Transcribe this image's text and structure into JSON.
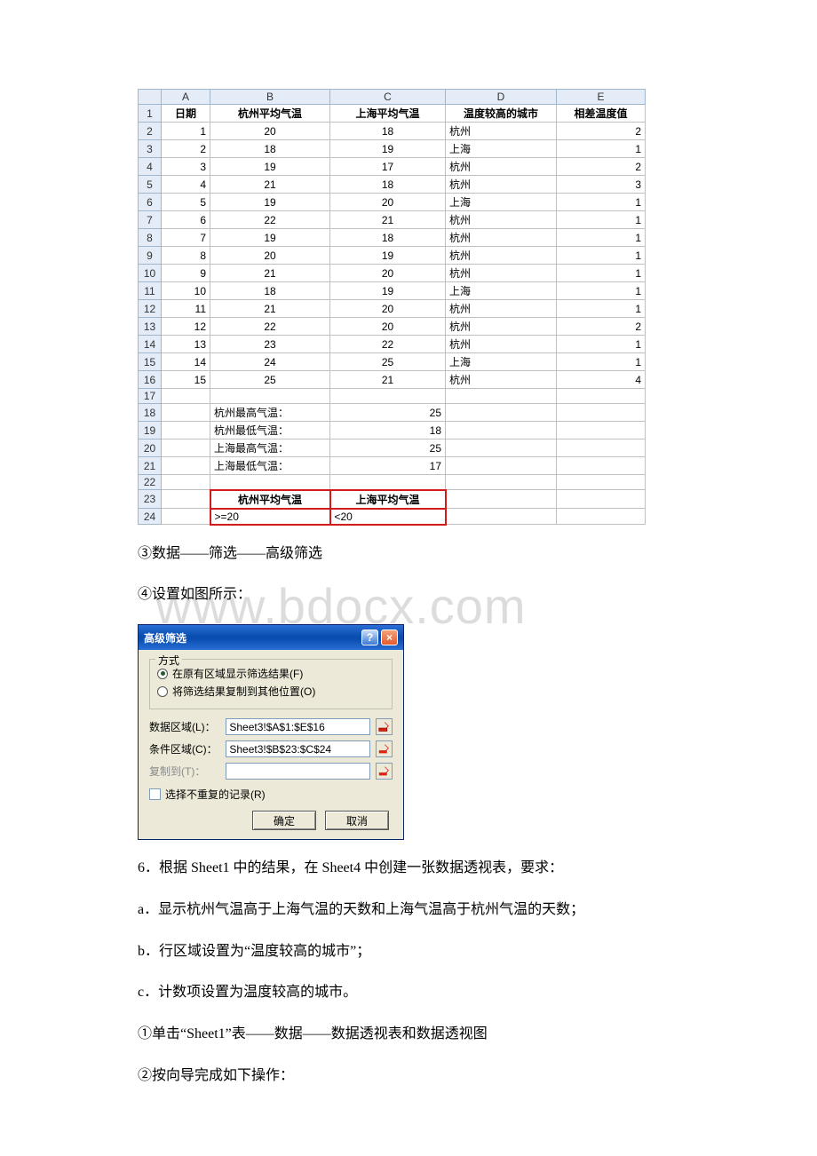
{
  "watermark": "www.bdocx.com",
  "sheet": {
    "columns": [
      "A",
      "B",
      "C",
      "D",
      "E"
    ],
    "headers": {
      "A": "日期",
      "B": "杭州平均气温",
      "C": "上海平均气温",
      "D": "温度较高的城市",
      "E": "相差温度值"
    },
    "rows": [
      {
        "n": "1",
        "A": "1",
        "B": "20",
        "C": "18",
        "D": "杭州",
        "E": "2"
      },
      {
        "n": "2",
        "A": "2",
        "B": "18",
        "C": "19",
        "D": "上海",
        "E": "1"
      },
      {
        "n": "3",
        "A": "3",
        "B": "19",
        "C": "17",
        "D": "杭州",
        "E": "2"
      },
      {
        "n": "4",
        "A": "4",
        "B": "21",
        "C": "18",
        "D": "杭州",
        "E": "3"
      },
      {
        "n": "5",
        "A": "5",
        "B": "19",
        "C": "20",
        "D": "上海",
        "E": "1"
      },
      {
        "n": "6",
        "A": "6",
        "B": "22",
        "C": "21",
        "D": "杭州",
        "E": "1"
      },
      {
        "n": "7",
        "A": "7",
        "B": "19",
        "C": "18",
        "D": "杭州",
        "E": "1"
      },
      {
        "n": "8",
        "A": "8",
        "B": "20",
        "C": "19",
        "D": "杭州",
        "E": "1"
      },
      {
        "n": "9",
        "A": "9",
        "B": "21",
        "C": "20",
        "D": "杭州",
        "E": "1"
      },
      {
        "n": "10",
        "A": "10",
        "B": "18",
        "C": "19",
        "D": "上海",
        "E": "1"
      },
      {
        "n": "11",
        "A": "11",
        "B": "21",
        "C": "20",
        "D": "杭州",
        "E": "1"
      },
      {
        "n": "12",
        "A": "12",
        "B": "22",
        "C": "20",
        "D": "杭州",
        "E": "2"
      },
      {
        "n": "13",
        "A": "13",
        "B": "23",
        "C": "22",
        "D": "杭州",
        "E": "1"
      },
      {
        "n": "14",
        "A": "14",
        "B": "24",
        "C": "25",
        "D": "上海",
        "E": "1"
      },
      {
        "n": "15",
        "A": "15",
        "B": "25",
        "C": "21",
        "D": "杭州",
        "E": "4"
      }
    ],
    "summary": [
      {
        "n": "18",
        "label": "杭州最高气温：",
        "val": "25"
      },
      {
        "n": "19",
        "label": "杭州最低气温：",
        "val": "18"
      },
      {
        "n": "20",
        "label": "上海最高气温：",
        "val": "25"
      },
      {
        "n": "21",
        "label": "上海最低气温：",
        "val": "17"
      }
    ],
    "criteria": {
      "rownum_hdr": "23",
      "rownum_val": "24",
      "B_hdr": "杭州平均气温",
      "C_hdr": "上海平均气温",
      "B_val": ">=20",
      "C_val": "<20"
    }
  },
  "step3": "③数据——筛选——高级筛选",
  "step4": "④设置如图所示：",
  "dialog": {
    "title": "高级筛选",
    "grp_label": "方式",
    "opt_inplace": "在原有区域显示筛选结果(F)",
    "opt_copy": "将筛选结果复制到其他位置(O)",
    "lbl_list": "数据区域(L)：",
    "lbl_crit": "条件区域(C)：",
    "lbl_copy": "复制到(T)：",
    "val_list": "Sheet3!$A$1:$E$16",
    "val_crit": "Sheet3!$B$23:$C$24",
    "val_copy": "",
    "chk_unique": "选择不重复的记录(R)",
    "btn_ok": "确定",
    "btn_cancel": "取消"
  },
  "text_q6": "6．根据 Sheet1 中的结果，在 Sheet4 中创建一张数据透视表，要求：",
  "text_a": "a．显示杭州气温高于上海气温的天数和上海气温高于杭州气温的天数；",
  "text_b": "b．行区域设置为“温度较高的城市”；",
  "text_c": "c．计数项设置为温度较高的城市。",
  "text_s1": "①单击“Sheet1”表——数据——数据透视表和数据透视图",
  "text_s2": "②按向导完成如下操作："
}
